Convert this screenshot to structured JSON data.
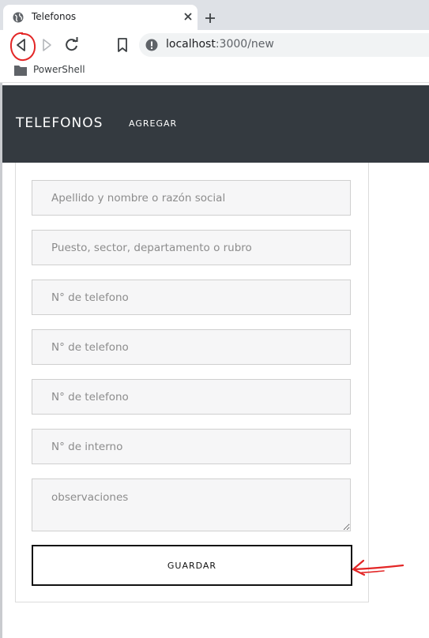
{
  "browser": {
    "tab_title": "Telefonos",
    "url_host": "localhost",
    "url_rest": ":3000/new",
    "bookmark_label": "PowerShell"
  },
  "navbar": {
    "brand": "TELEFONOS",
    "link_agregar": "AGREGAR"
  },
  "form": {
    "placeholders": {
      "nombre": "Apellido y nombre o razón social",
      "puesto": "Puesto, sector, departamento o rubro",
      "telefono1": "N° de telefono",
      "telefono2": "N° de telefono",
      "telefono3": "N° de telefono",
      "interno": "N° de interno",
      "observaciones": "observaciones"
    },
    "submit_label": "GUARDAR"
  },
  "colors": {
    "navbar_bg": "#343a40",
    "annotation": "#e32626"
  }
}
